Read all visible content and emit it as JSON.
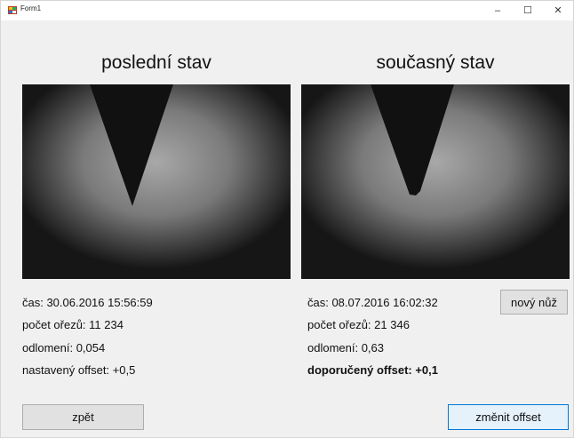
{
  "window": {
    "title": "Form1",
    "minimize": "–",
    "maximize": "☐",
    "close": "✕"
  },
  "left": {
    "heading": "poslední stav",
    "time_line": "čas: 30.06.2016 15:56:59",
    "cuts_line": "počet ořezů: 11 234",
    "breakage_line": "odlomení: 0,054",
    "offset_line": "nastavený offset: +0,5",
    "back_button": "zpět"
  },
  "right": {
    "heading": "současný stav",
    "time_line": "čas: 08.07.2016 16:02:32",
    "cuts_line": "počet ořezů: 21 346",
    "breakage_line": "odlomení: 0,63",
    "offset_line": "doporučený offset: +0,1",
    "new_knife_button": "nový nůž",
    "change_offset_button": "změnit offset"
  }
}
